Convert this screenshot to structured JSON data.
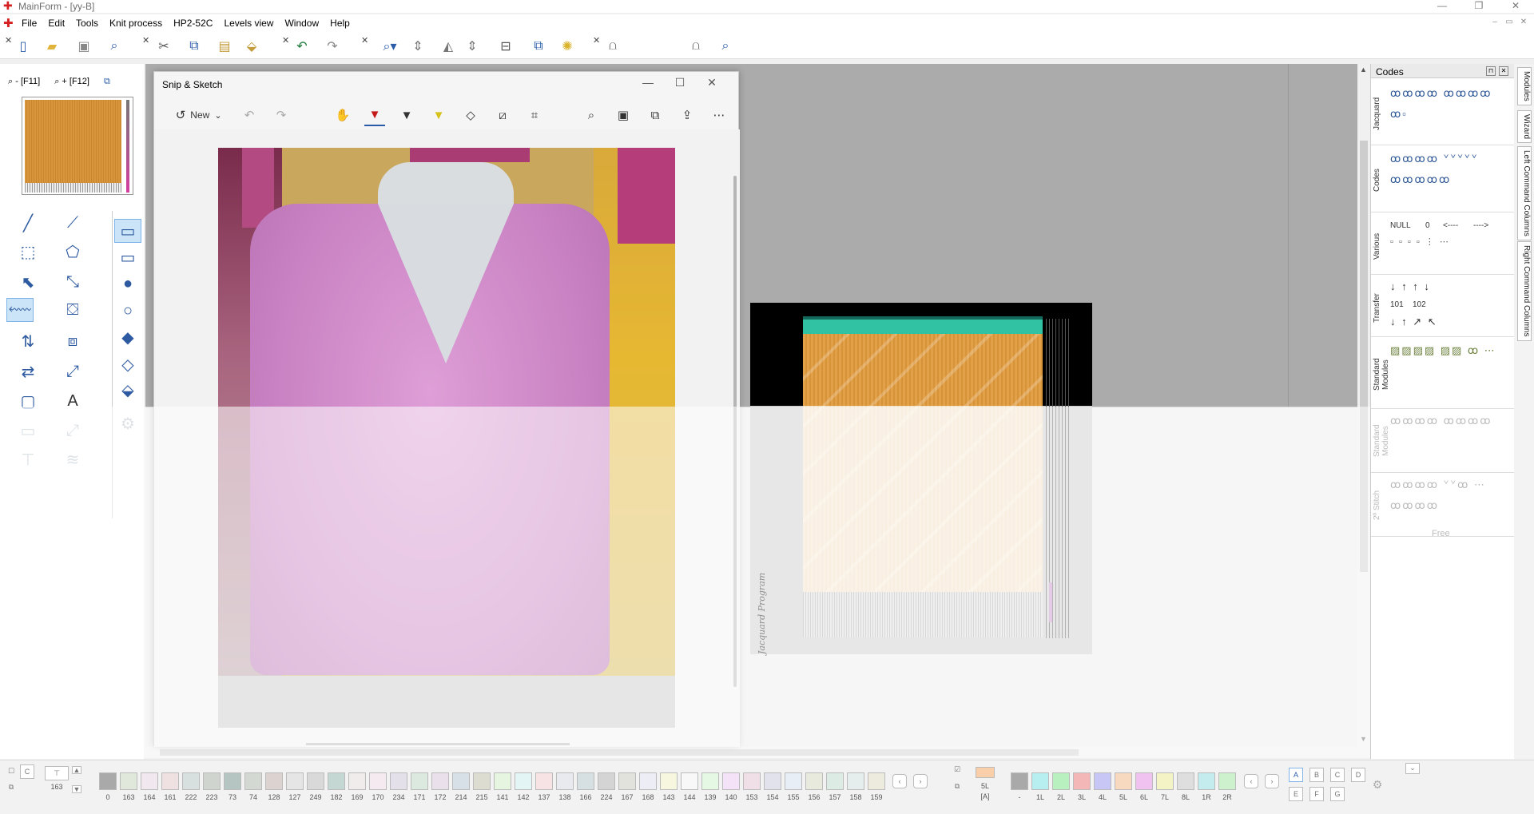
{
  "window": {
    "title": "MainForm - [yy-B]",
    "controls": [
      "—",
      "❐",
      "✕"
    ],
    "mdi_controls": [
      "–",
      "▭",
      "✕"
    ]
  },
  "menu": [
    "File",
    "Edit",
    "Tools",
    "Knit process",
    "HP2-52C",
    "Levels view",
    "Window",
    "Help"
  ],
  "toolbar_icons": [
    "new-file-icon",
    "open-folder-icon",
    "save-icon",
    "preview-icon",
    "cut-icon",
    "copy-icon",
    "paste-icon",
    "paste-special-icon",
    "undo-icon",
    "redo-icon",
    "zoom-icon",
    "zoom-arrows-icon",
    "tilt-icon",
    "split-icon",
    "layout-icon",
    "windows-icon",
    "bulb-icon",
    "stitch-icon",
    "compare-icon",
    "magnifier-doc-icon"
  ],
  "zoom": {
    "out": "- [F11]",
    "in": "+ [F12]"
  },
  "snip": {
    "title": "Snip & Sketch",
    "new_label": "New",
    "controls": [
      "—",
      "☐",
      "✕"
    ]
  },
  "jacquard": {
    "label": "Jacquard Program"
  },
  "codes": {
    "title": "Codes",
    "sections": [
      {
        "label": "Jacquard"
      },
      {
        "label": "Codes"
      },
      {
        "label": "Various",
        "texts": [
          "NULL",
          "0",
          "<----",
          "---->"
        ]
      },
      {
        "label": "Transfer",
        "texts": [
          "101",
          "102"
        ]
      },
      {
        "label": "Standard Modules"
      },
      {
        "label": "Standard Modules"
      },
      {
        "label": "2º Stitch"
      }
    ],
    "free_label": "Free"
  },
  "side_tabs": [
    "Modules",
    "Wizard",
    "Left Command Columns",
    "Right Command Columns"
  ],
  "palette": {
    "current": "163",
    "letters": [
      "C"
    ],
    "swatches": [
      {
        "n": "0",
        "c": "#a9a9a9"
      },
      {
        "n": "163",
        "c": "#dfe8da"
      },
      {
        "n": "164",
        "c": "#f1e7ef"
      },
      {
        "n": "161",
        "c": "#efe1e1"
      },
      {
        "n": "222",
        "c": "#d7e0de"
      },
      {
        "n": "223",
        "c": "#cfd4cf"
      },
      {
        "n": "73",
        "c": "#b5c5c1"
      },
      {
        "n": "74",
        "c": "#d3d8d3"
      },
      {
        "n": "128",
        "c": "#dcd2cf"
      },
      {
        "n": "127",
        "c": "#e5e5e5"
      },
      {
        "n": "249",
        "c": "#d9d9d9"
      },
      {
        "n": "182",
        "c": "#c5d7d2"
      },
      {
        "n": "169",
        "c": "#f1ecec"
      },
      {
        "n": "170",
        "c": "#f5eaf0"
      },
      {
        "n": "234",
        "c": "#e3e0ea"
      },
      {
        "n": "171",
        "c": "#dbe9df"
      },
      {
        "n": "172",
        "c": "#e9e0ec"
      },
      {
        "n": "214",
        "c": "#d8e0e7"
      },
      {
        "n": "215",
        "c": "#dcdcd0"
      },
      {
        "n": "141",
        "c": "#e5f5e0"
      },
      {
        "n": "142",
        "c": "#e3f5f5"
      },
      {
        "n": "137",
        "c": "#f7e3e3"
      },
      {
        "n": "138",
        "c": "#e8eaf0"
      },
      {
        "n": "166",
        "c": "#d6e0e2"
      },
      {
        "n": "224",
        "c": "#d4d4d4"
      },
      {
        "n": "167",
        "c": "#e2e2dc"
      },
      {
        "n": "168",
        "c": "#ededf5"
      },
      {
        "n": "143",
        "c": "#f7f7df"
      },
      {
        "n": "144",
        "c": "#f8f8f8"
      },
      {
        "n": "139",
        "c": "#e4f8e4"
      },
      {
        "n": "140",
        "c": "#f4e3f8"
      },
      {
        "n": "153",
        "c": "#f0dfe6"
      },
      {
        "n": "154",
        "c": "#e2e2ed"
      },
      {
        "n": "155",
        "c": "#e7eef5"
      },
      {
        "n": "156",
        "c": "#e9eade"
      },
      {
        "n": "157",
        "c": "#dcebe3"
      },
      {
        "n": "158",
        "c": "#e6eded"
      },
      {
        "n": "159",
        "c": "#ecebdd"
      }
    ],
    "level": {
      "top": "5L",
      "bottom": "[A]"
    },
    "layers": [
      {
        "n": "-",
        "c": "#a9a9a9"
      },
      {
        "n": "1L",
        "c": "#b7eef0"
      },
      {
        "n": "2L",
        "c": "#b8f0c0"
      },
      {
        "n": "3L",
        "c": "#f3b7b7"
      },
      {
        "n": "4L",
        "c": "#c7c6f4"
      },
      {
        "n": "5L",
        "c": "#f7d9c0"
      },
      {
        "n": "6L",
        "c": "#f0c2f0"
      },
      {
        "n": "7L",
        "c": "#f3f3c6"
      },
      {
        "n": "8L",
        "c": "#dedede"
      },
      {
        "n": "1R",
        "c": "#c4ebee"
      },
      {
        "n": "2R",
        "c": "#cdf1cd"
      }
    ],
    "grid_letters": [
      "A",
      "B",
      "C",
      "D",
      "E",
      "F",
      "G"
    ]
  }
}
